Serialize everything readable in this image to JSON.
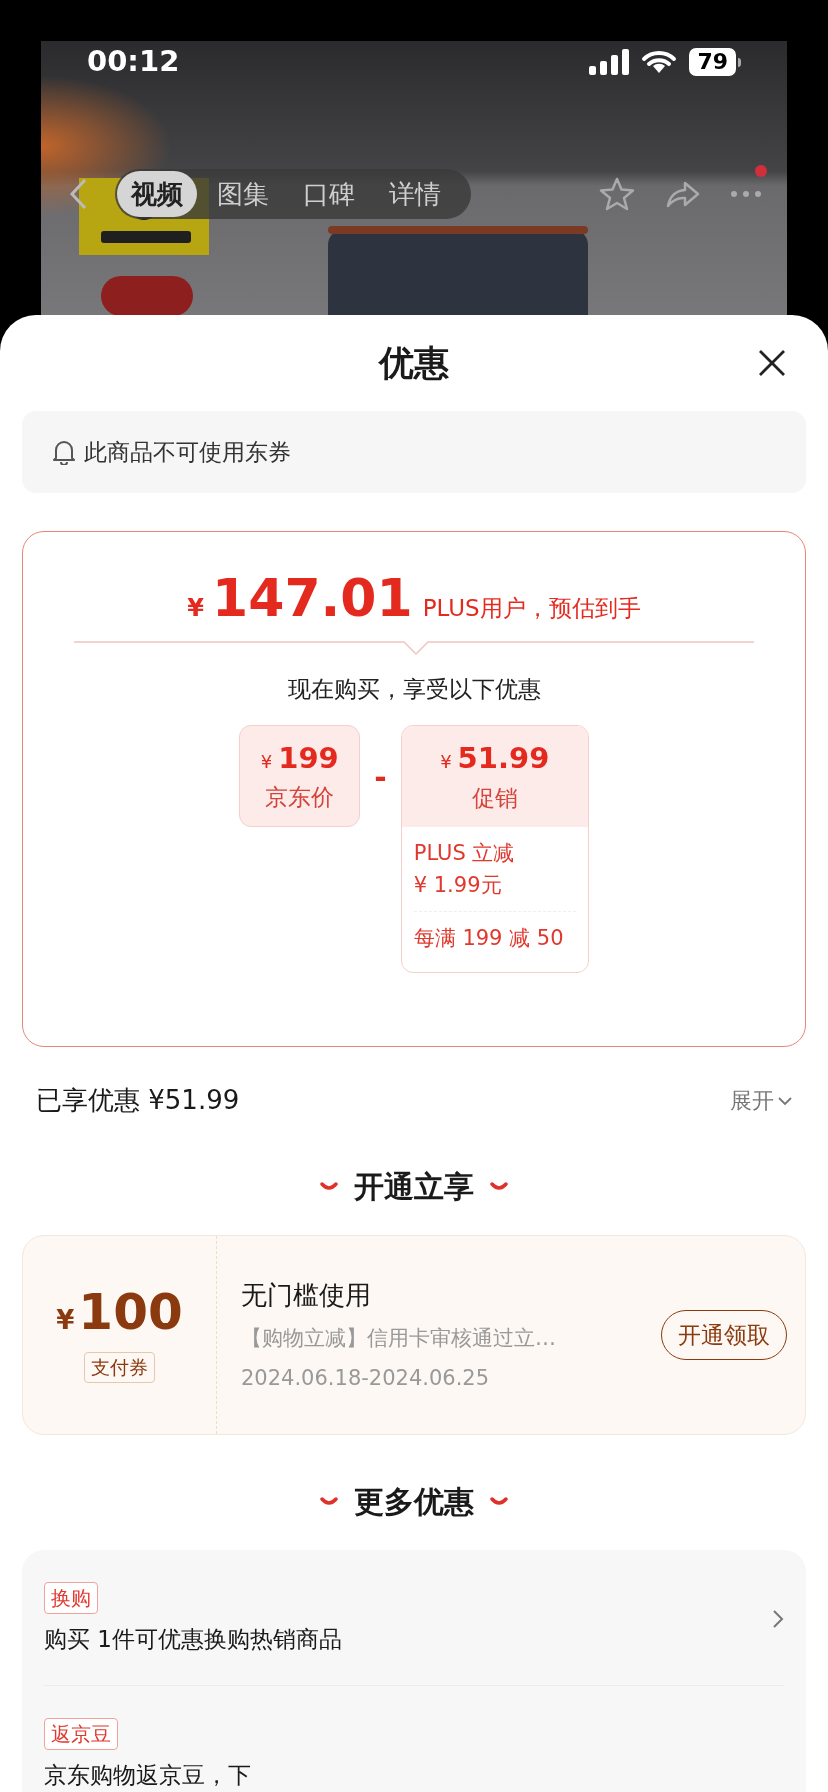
{
  "status_bar": {
    "time": "00:12",
    "battery": "79"
  },
  "nav": {
    "tabs": [
      {
        "label": "视频",
        "selected": true
      },
      {
        "label": "图集",
        "selected": false
      },
      {
        "label": "口碑",
        "selected": false
      },
      {
        "label": "详情",
        "selected": false
      }
    ],
    "notification": true
  },
  "sheet": {
    "title": "优惠",
    "notice": "此商品不可使用东券",
    "estimate": {
      "currency": "¥",
      "price": "147.01",
      "caption": "PLUS用户，预估到手",
      "subtitle": "现在购买，享受以下优惠",
      "base": {
        "currency": "¥",
        "amount": "199",
        "label": "京东价"
      },
      "operator": "-",
      "discount": {
        "currency": "¥",
        "amount": "51.99",
        "label": "促销",
        "details": [
          {
            "lines": [
              "PLUS 立减",
              "¥ 1.99元"
            ]
          },
          {
            "lines": [
              "每满 199 减 50"
            ]
          }
        ]
      }
    },
    "saved": {
      "label": "已享优惠 ¥51.99",
      "toggle": "展开"
    },
    "open_section": {
      "title": "开通立享",
      "coupon": {
        "currency": "¥",
        "amount": "100",
        "tag": "支付券",
        "title": "无门槛使用",
        "description": "【购物立减】信用卡审核通过立…",
        "validity": "2024.06.18-2024.06.25",
        "action": "开通领取"
      }
    },
    "more_section": {
      "title": "更多优惠",
      "items": [
        {
          "tag": "换购",
          "text": "购买 1件可优惠换购热销商品",
          "arrow": true
        },
        {
          "tag": "返京豆",
          "text": "京东购物返京豆，下",
          "arrow": false
        }
      ]
    }
  }
}
